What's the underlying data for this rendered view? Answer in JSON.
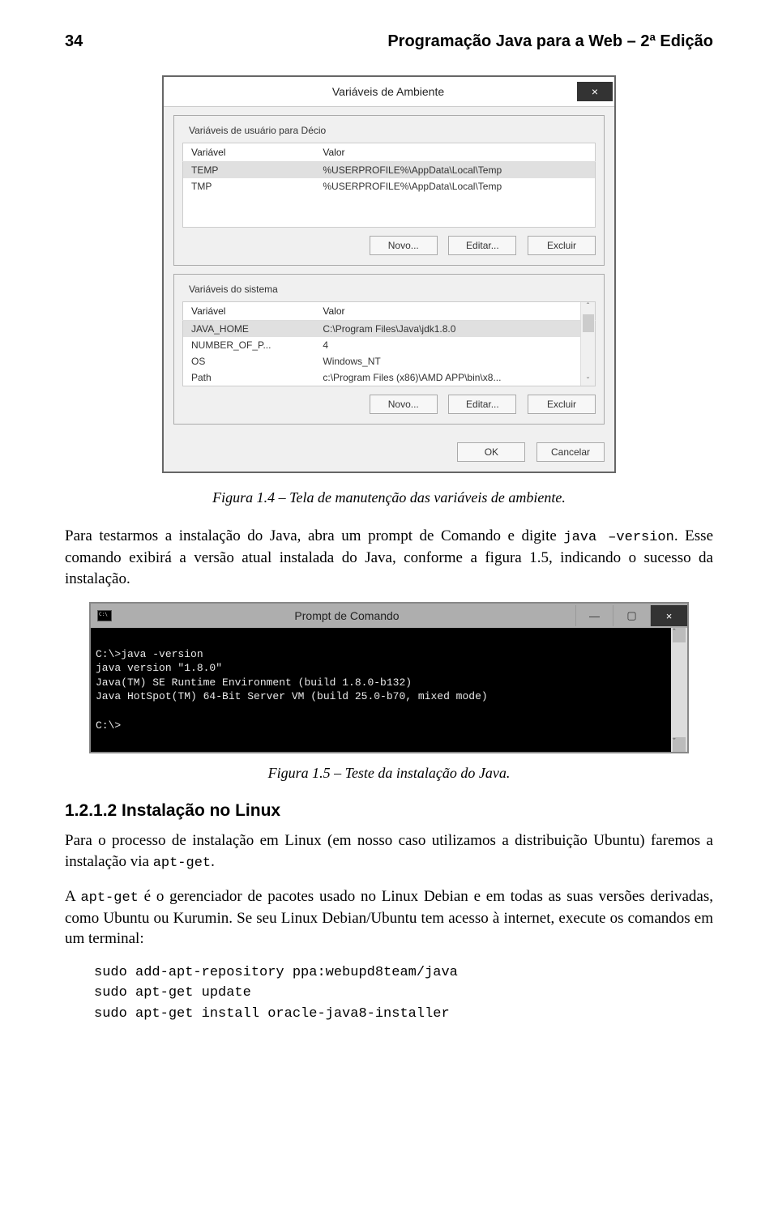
{
  "header": {
    "page_number": "34",
    "book_title": "Programação Java para a Web – 2ª Edição"
  },
  "env_dialog": {
    "title": "Variáveis de Ambiente",
    "close_glyph": "×",
    "user_group_label": "Variáveis de usuário para Décio",
    "sys_group_label": "Variáveis do sistema",
    "col_var": "Variável",
    "col_val": "Valor",
    "user_rows": [
      {
        "var": "TEMP",
        "val": "%USERPROFILE%\\AppData\\Local\\Temp",
        "selected": true
      },
      {
        "var": "TMP",
        "val": "%USERPROFILE%\\AppData\\Local\\Temp",
        "selected": false
      }
    ],
    "sys_rows": [
      {
        "var": "JAVA_HOME",
        "val": "C:\\Program Files\\Java\\jdk1.8.0",
        "selected": true
      },
      {
        "var": "NUMBER_OF_P...",
        "val": "4",
        "selected": false
      },
      {
        "var": "OS",
        "val": "Windows_NT",
        "selected": false
      },
      {
        "var": "Path",
        "val": "c:\\Program Files (x86)\\AMD APP\\bin\\x8...",
        "selected": false
      }
    ],
    "btn_new": "Novo...",
    "btn_edit": "Editar...",
    "btn_delete": "Excluir",
    "btn_ok": "OK",
    "btn_cancel": "Cancelar",
    "scroll_up": "ˆ",
    "scroll_down": "ˇ"
  },
  "fig14_caption": "Figura 1.4 – Tela de manutenção das variáveis de ambiente.",
  "para1_a": "Para testarmos a instalação do Java, abra um prompt de Comando e digite ",
  "para1_code": "java –version",
  "para1_b": ". Esse comando exibirá a versão atual instalada do Java, conforme a figura 1.5, indicando o sucesso da instalação.",
  "cmd": {
    "title": "Prompt de Comando",
    "min": "—",
    "max": "▢",
    "close": "×",
    "scr_up": "ˆ",
    "scr_down": "ˇ",
    "output": "\nC:\\>java -version\njava version \"1.8.0\"\nJava(TM) SE Runtime Environment (build 1.8.0-b132)\nJava HotSpot(TM) 64-Bit Server VM (build 25.0-b70, mixed mode)\n\nC:\\>"
  },
  "fig15_caption": "Figura 1.5 – Teste da instalação do Java.",
  "sec_heading": "1.2.1.2 Instalação no Linux",
  "para2_a": "Para o processo de instalação em Linux (em nosso caso utilizamos a distribuição Ubuntu) faremos a instalação via ",
  "para2_code": "apt-get",
  "para2_b": ".",
  "para3_a": "A ",
  "para3_code": "apt-get",
  "para3_b": " é o gerenciador de pacotes usado no Linux Debian e em todas as suas versões derivadas, como Ubuntu ou Kurumin. Se seu Linux Debian/Ubuntu tem acesso à internet, execute os comandos em um terminal:",
  "code_lines": [
    "sudo add-apt-repository ppa:webupd8team/java",
    "sudo apt-get update",
    "sudo apt-get install oracle-java8-installer"
  ]
}
